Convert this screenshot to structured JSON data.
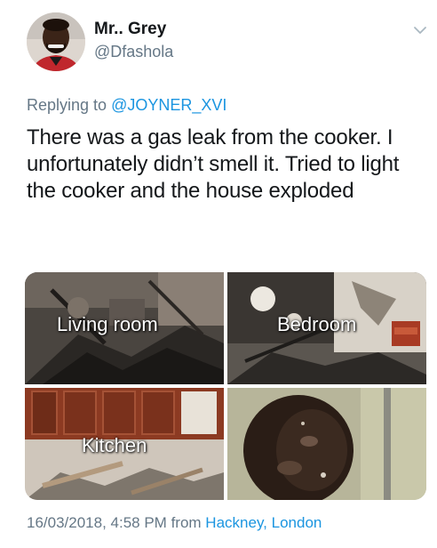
{
  "author": {
    "display_name": "Mr.. Grey",
    "handle": "@Dfashola",
    "avatar_icon": "profile-photo"
  },
  "reply": {
    "prefix": "Replying to ",
    "mention": "@JOYNER_XVI"
  },
  "tweet": {
    "text": "There was a gas leak from the cooker. I unfortunately didn’t smell it. Tried to light the cooker and the house exploded"
  },
  "media": {
    "tiles": [
      {
        "label": "Living room"
      },
      {
        "label": "Bedroom"
      },
      {
        "label": "Kitchen"
      },
      {
        "label": ""
      }
    ]
  },
  "meta": {
    "timestamp": "16/03/2018, 4:58 PM",
    "from_text": " from ",
    "location": "Hackney, London"
  },
  "colors": {
    "link_blue": "#1b95e0",
    "muted_grey": "#657786",
    "text_dark": "#14171a"
  },
  "icons": {
    "menu": "chevron-down-icon"
  }
}
